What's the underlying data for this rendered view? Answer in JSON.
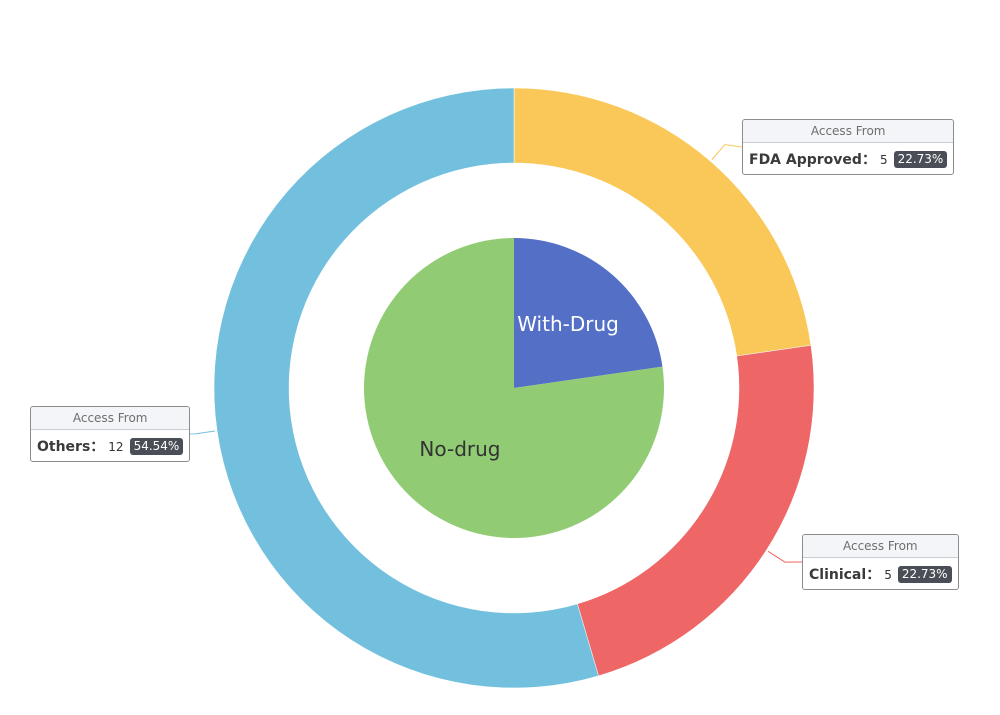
{
  "chart_data": {
    "type": "pie",
    "inner": {
      "type": "pie",
      "slices": [
        {
          "name": "With-Drug",
          "value": 5,
          "color": "#5470c6",
          "label_color": "#ffffff"
        },
        {
          "name": "No-drug",
          "value": 17,
          "color": "#91cc75",
          "label_color": "#333333"
        }
      ]
    },
    "outer": {
      "type": "donut",
      "callout_header": "Access From",
      "slices": [
        {
          "name": "FDA Approved",
          "value": 5,
          "percent": "22.73%",
          "color": "#fac858"
        },
        {
          "name": "Clinical",
          "value": 5,
          "percent": "22.73%",
          "color": "#ee6666"
        },
        {
          "name": "Others",
          "value": 12,
          "percent": "54.54%",
          "color": "#73c0de"
        }
      ]
    }
  }
}
